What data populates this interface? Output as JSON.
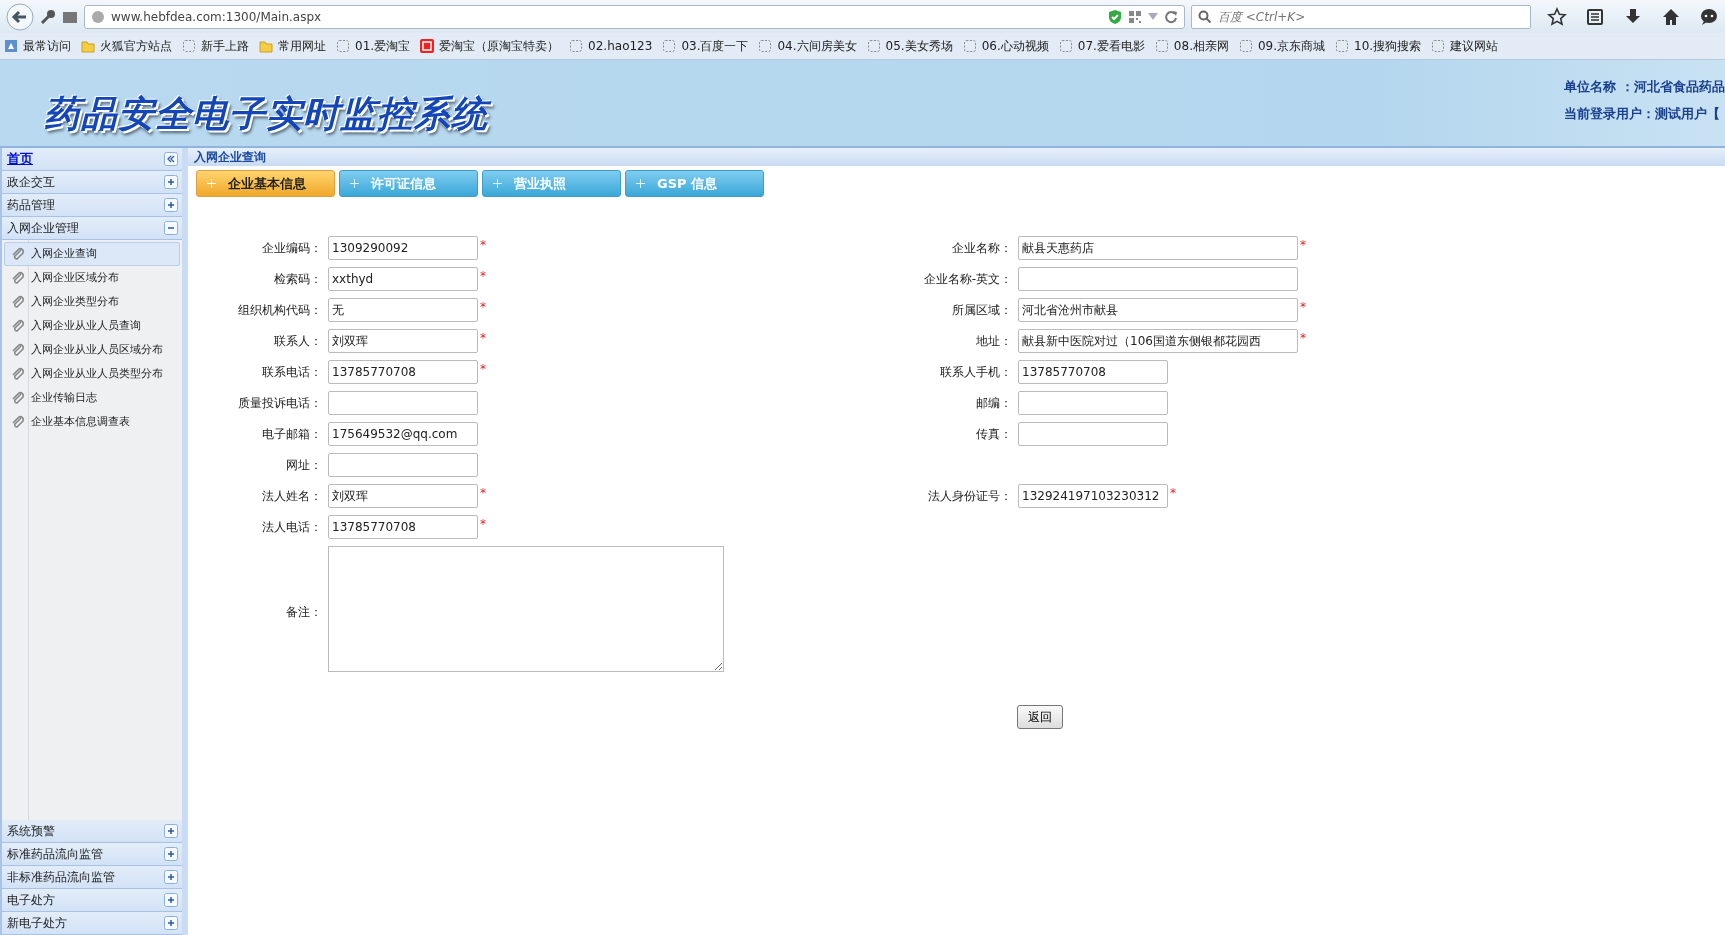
{
  "browser": {
    "url": "www.hebfdea.com:1300/Main.aspx",
    "search_placeholder": "百度 <Ctrl+K>",
    "bookmarks": [
      {
        "kind": "star",
        "label": "最常访问"
      },
      {
        "kind": "folder",
        "label": "火狐官方站点"
      },
      {
        "kind": "page",
        "label": "新手上路"
      },
      {
        "kind": "folder",
        "label": "常用网址"
      },
      {
        "kind": "page",
        "label": "01.爱淘宝"
      },
      {
        "kind": "shop",
        "label": "爱淘宝（原淘宝特卖）"
      },
      {
        "kind": "page",
        "label": "02.hao123"
      },
      {
        "kind": "page",
        "label": "03.百度一下"
      },
      {
        "kind": "page",
        "label": "04.六间房美女"
      },
      {
        "kind": "page",
        "label": "05.美女秀场"
      },
      {
        "kind": "page",
        "label": "06.心动视频"
      },
      {
        "kind": "page",
        "label": "07.爱看电影"
      },
      {
        "kind": "page",
        "label": "08.相亲网"
      },
      {
        "kind": "page",
        "label": "09.京东商城"
      },
      {
        "kind": "page",
        "label": "10.搜狗搜索"
      },
      {
        "kind": "page",
        "label": "建议网站"
      }
    ]
  },
  "header": {
    "title": "药品安全电子实时监控系统",
    "unit": "单位名称 ：河北省食品药品",
    "user": "当前登录用户：测试用户【"
  },
  "sidebar": {
    "home": "首页",
    "sections": [
      {
        "label": "政企交互",
        "expanded": false
      },
      {
        "label": "药品管理",
        "expanded": false
      },
      {
        "label": "入网企业管理",
        "expanded": true,
        "children": [
          {
            "label": "入网企业查询",
            "selected": true
          },
          {
            "label": "入网企业区域分布",
            "selected": false
          },
          {
            "label": "入网企业类型分布",
            "selected": false
          },
          {
            "label": "入网企业从业人员查询",
            "selected": false
          },
          {
            "label": "入网企业从业人员区域分布",
            "selected": false
          },
          {
            "label": "入网企业从业人员类型分布",
            "selected": false
          },
          {
            "label": "企业传输日志",
            "selected": false
          },
          {
            "label": "企业基本信息调查表",
            "selected": false
          }
        ]
      },
      {
        "label": "系统预警",
        "expanded": false
      },
      {
        "label": "标准药品流向监管",
        "expanded": false
      },
      {
        "label": "非标准药品流向监管",
        "expanded": false
      },
      {
        "label": "电子处方",
        "expanded": false
      },
      {
        "label": "新电子处方",
        "expanded": false
      }
    ]
  },
  "breadcrumb": "入网企业查询",
  "tabs": [
    {
      "label": "企业基本信息",
      "selected": true
    },
    {
      "label": "许可证信息",
      "selected": false
    },
    {
      "label": "营业执照",
      "selected": false
    },
    {
      "label": "GSP 信息",
      "selected": false
    }
  ],
  "form": {
    "rows": [
      {
        "left": {
          "label": "企业编码：",
          "value": "1309290092",
          "mark": "*"
        },
        "right": {
          "label": "企业名称：",
          "value": "献县天惠药店",
          "mark": "*",
          "wide": true
        }
      },
      {
        "left": {
          "label": "检索码：",
          "value": "xxthyd",
          "mark": "*"
        },
        "right": {
          "label": "企业名称-英文：",
          "wide": true
        }
      },
      {
        "left": {
          "label": "组织机构代码：",
          "value": "无",
          "mark": "*"
        },
        "right": {
          "label": "所属区域：",
          "value": "河北省沧州市献县",
          "mark": "*",
          "wide": true
        }
      },
      {
        "left": {
          "label": "联系人：",
          "value": "刘双珲",
          "mark": "*"
        },
        "right": {
          "label": "地址：",
          "value": "献县新中医院对过（106国道东侧银都花园西",
          "mark": "*",
          "wide": true
        }
      },
      {
        "left": {
          "label": "联系电话：",
          "value": "13785770708",
          "mark": "*"
        },
        "right": {
          "label": "联系人手机：",
          "value": "13785770708",
          "wide": false
        }
      },
      {
        "left": {
          "label": "质量投诉电话："
        },
        "right": {
          "label": "邮编：",
          "wide": false
        }
      },
      {
        "left": {
          "label": "电子邮箱：",
          "value": "175649532@qq.com"
        },
        "right": {
          "label": "传真：",
          "wide": false
        }
      },
      {
        "left": {
          "label": "网址："
        }
      },
      {
        "left": {
          "label": "法人姓名：",
          "value": "刘双珲",
          "mark": "*"
        },
        "right": {
          "label": "法人身份证号：",
          "value": "132924197103230312",
          "mark": "*",
          "wide": false
        }
      },
      {
        "left": {
          "label": "法人电话：",
          "value": "13785770708",
          "mark": "*"
        }
      }
    ],
    "remark_label": "备注：",
    "back_button": "返回"
  }
}
